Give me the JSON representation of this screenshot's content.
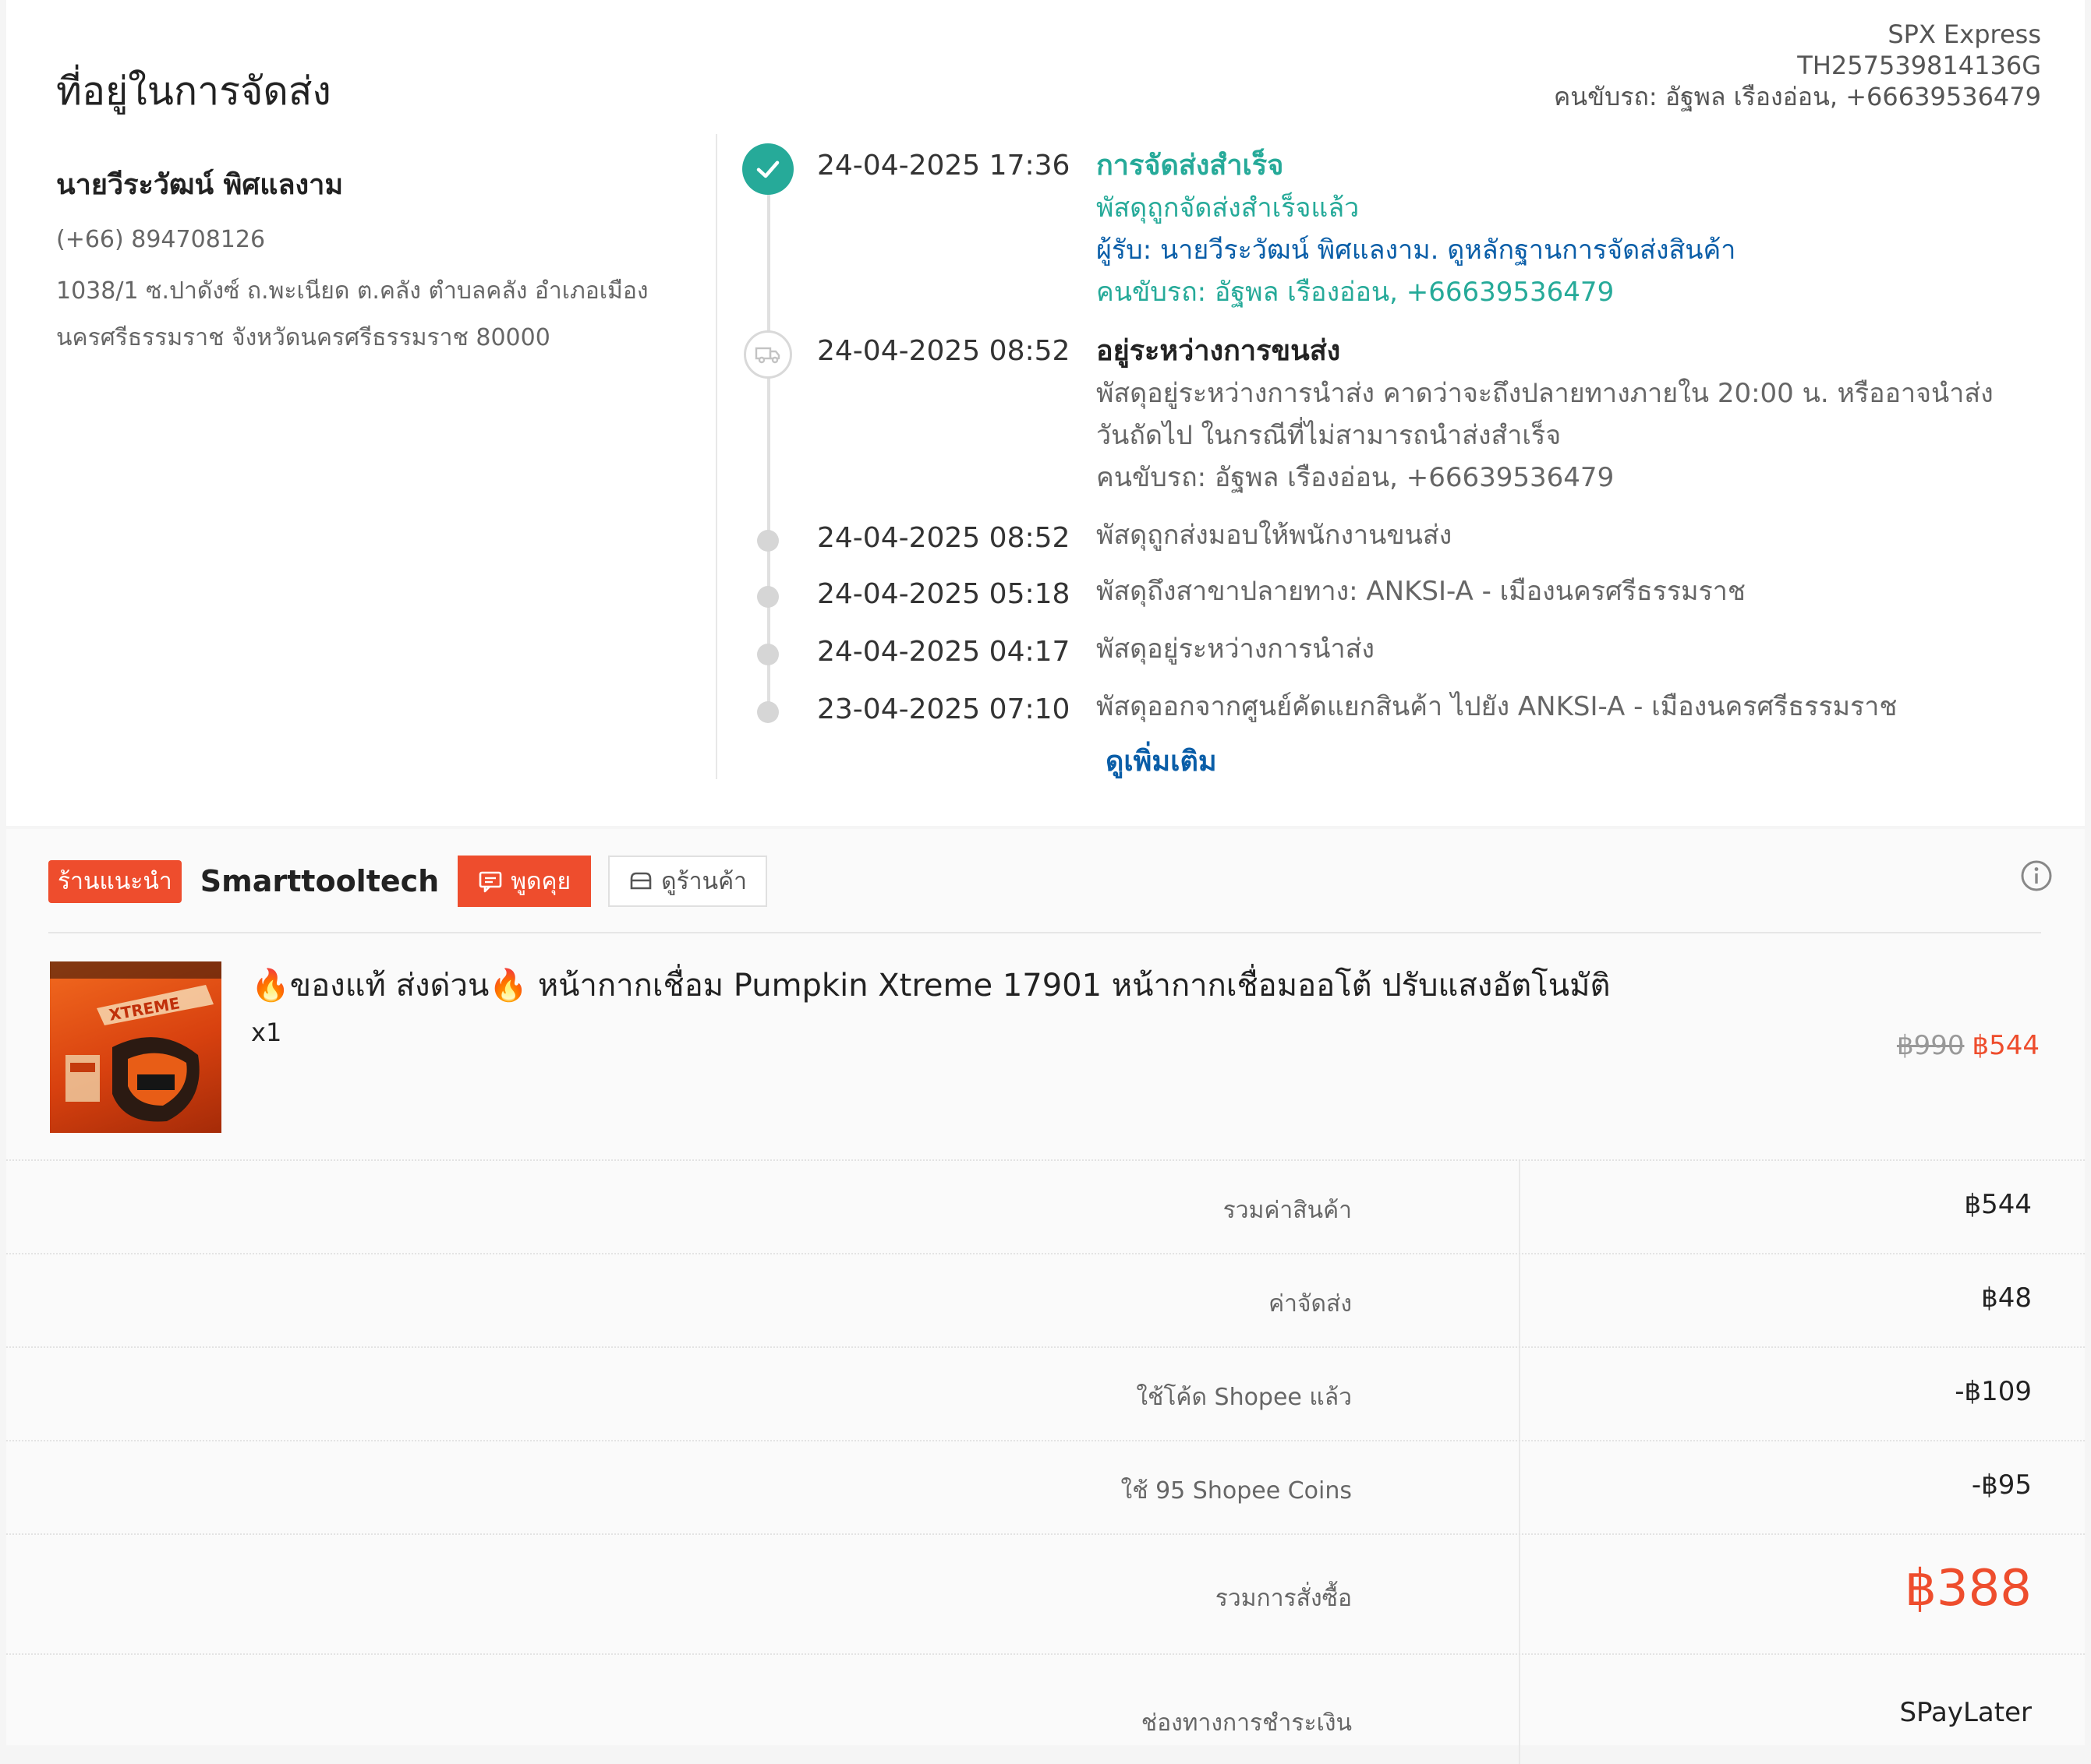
{
  "address_section": {
    "title": "ที่อยู่ในการจัดส่ง",
    "carrier": {
      "name": "SPX Express",
      "tracking_number": "TH257539814136G",
      "driver": "คนขับรถ: อัฐพล เรืองอ่อน, +66639536479"
    },
    "recipient": {
      "name": "นายวีระวัฒน์ พิศแลงาม",
      "phone": "(+66) 894708126",
      "address_line1": "1038/1 ซ.ปาดังซ์ ถ.พะเนียด ต.คลัง ตำบลคลัง อำเภอเมือง",
      "address_line2": "นครศรีธรรมราช จังหวัดนครศรีธรรมราช 80000"
    }
  },
  "timeline": {
    "events": [
      {
        "time": "24-04-2025 17:36",
        "status": "การจัดส่งสำเร็จ",
        "detail": "พัสดุถูกจัดส่งสำเร็จแล้ว",
        "receiver": "ผู้รับ: นายวีระวัฒน์ พิศแลงาม.",
        "proof_link": "ดูหลักฐานการจัดส่งสินค้า",
        "driver": "คนขับรถ: อัฐพล เรืองอ่อน, +66639536479"
      },
      {
        "time": "24-04-2025 08:52",
        "status": "อยู่ระหว่างการขนส่ง",
        "detail_line1": "พัสดุอยู่ระหว่างการนำส่ง คาดว่าจะถึงปลายทางภายใน 20:00 น. หรืออาจนำส่ง",
        "detail_line2": "วันถัดไป ในกรณีที่ไม่สามารถนำส่งสำเร็จ",
        "driver": "คนขับรถ: อัฐพล เรืองอ่อน, +66639536479"
      },
      {
        "time": "24-04-2025 08:52",
        "detail": "พัสดุถูกส่งมอบให้พนักงานขนส่ง"
      },
      {
        "time": "24-04-2025 05:18",
        "detail": "พัสดุถึงสาขาปลายทาง: ANKSI-A - เมืองนครศรีธรรมราช"
      },
      {
        "time": "24-04-2025 04:17",
        "detail": "พัสดุอยู่ระหว่างการนำส่ง"
      },
      {
        "time": "23-04-2025 07:10",
        "detail": "พัสดุออกจากศูนย์คัดแยกสินค้า ไปยัง ANKSI-A - เมืองนครศรีธรรมราช"
      }
    ],
    "more_label": "ดูเพิ่มเติม"
  },
  "shop": {
    "badge": "ร้านแนะนำ",
    "name": "Smarttooltech",
    "chat_label": "พูดคุย",
    "view_shop_label": "ดูร้านค้า"
  },
  "product": {
    "title": "🔥ของแท้ ส่งด่วน🔥 หน้ากากเชื่อม Pumpkin Xtreme 17901 หน้ากากเชื่อมออโต้ ปรับแสงอัตโนมัติ",
    "quantity": "x1",
    "original_price": "฿990",
    "price": "฿544",
    "image_text": "XTREME"
  },
  "summary": {
    "rows": [
      {
        "label": "รวมค่าสินค้า",
        "value": "฿544"
      },
      {
        "label": "ค่าจัดส่ง",
        "value": "฿48"
      },
      {
        "label": "ใช้โค้ด Shopee แล้ว",
        "value": "-฿109"
      },
      {
        "label": "ใช้ 95 Shopee Coins",
        "value": "-฿95"
      }
    ],
    "total_label": "รวมการสั่งซื้อ",
    "total_value": "฿388",
    "payment_label": "ช่องทางการชำระเงิน",
    "payment_value": "SPayLater"
  },
  "colors": {
    "accent": "#ee4d2d",
    "success": "#26aa99",
    "link": "#0a5ea8"
  }
}
